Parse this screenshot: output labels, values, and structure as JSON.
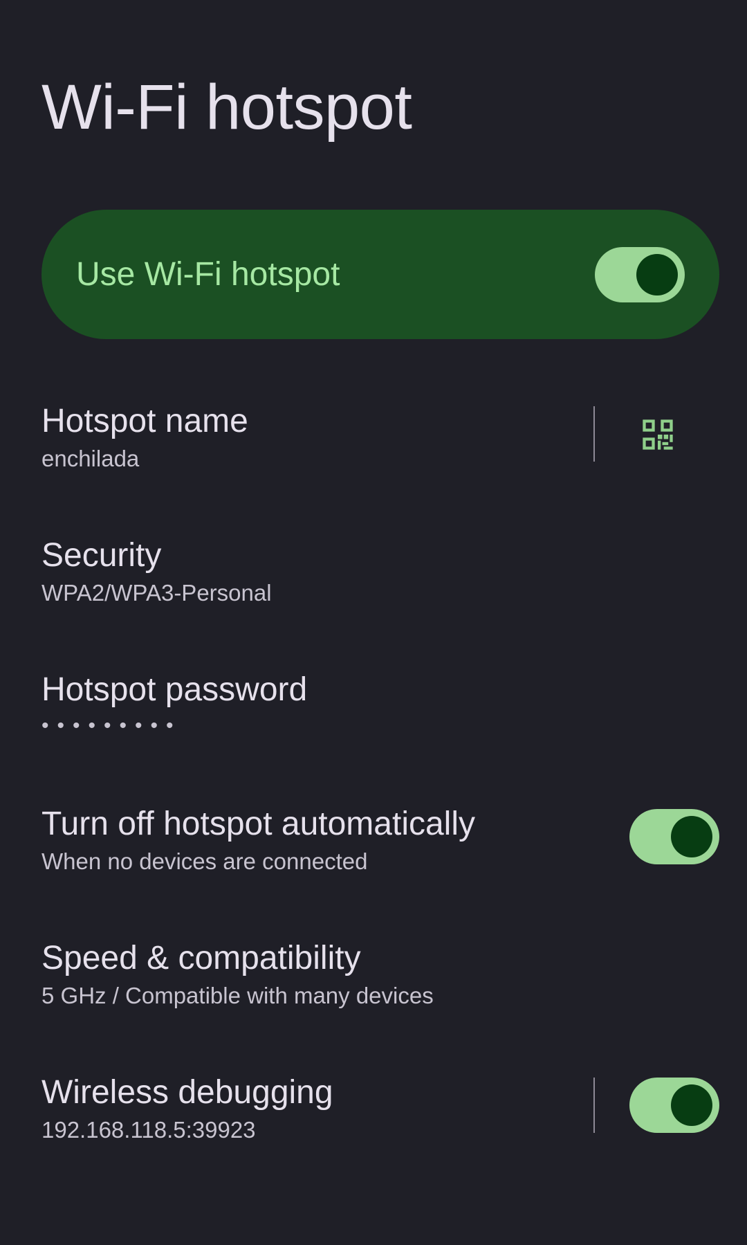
{
  "header": {
    "title": "Wi-Fi hotspot"
  },
  "main_switch": {
    "label": "Use Wi-Fi hotspot",
    "checked": true
  },
  "settings": {
    "hotspot_name": {
      "title": "Hotspot name",
      "summary": "enchilada",
      "action_icon": "qr-code-icon"
    },
    "security": {
      "title": "Security",
      "summary": "WPA2/WPA3-Personal"
    },
    "password": {
      "title": "Hotspot password",
      "summary": "•••••••••"
    },
    "auto_off": {
      "title": "Turn off hotspot automatically",
      "summary": "When no devices are connected",
      "checked": true
    },
    "speed": {
      "title": "Speed & compatibility",
      "summary": "5 GHz / Compatible with many devices"
    },
    "wireless_debugging": {
      "title": "Wireless debugging",
      "summary": "192.168.118.5:39923",
      "checked": true
    }
  },
  "colors": {
    "background": "#1f1f27",
    "main_switch_bg": "#1b5023",
    "main_switch_text": "#a6e8a3",
    "toggle_track": "#9cd797",
    "toggle_thumb": "#073d12",
    "accent_icon": "#8fcf8a"
  }
}
